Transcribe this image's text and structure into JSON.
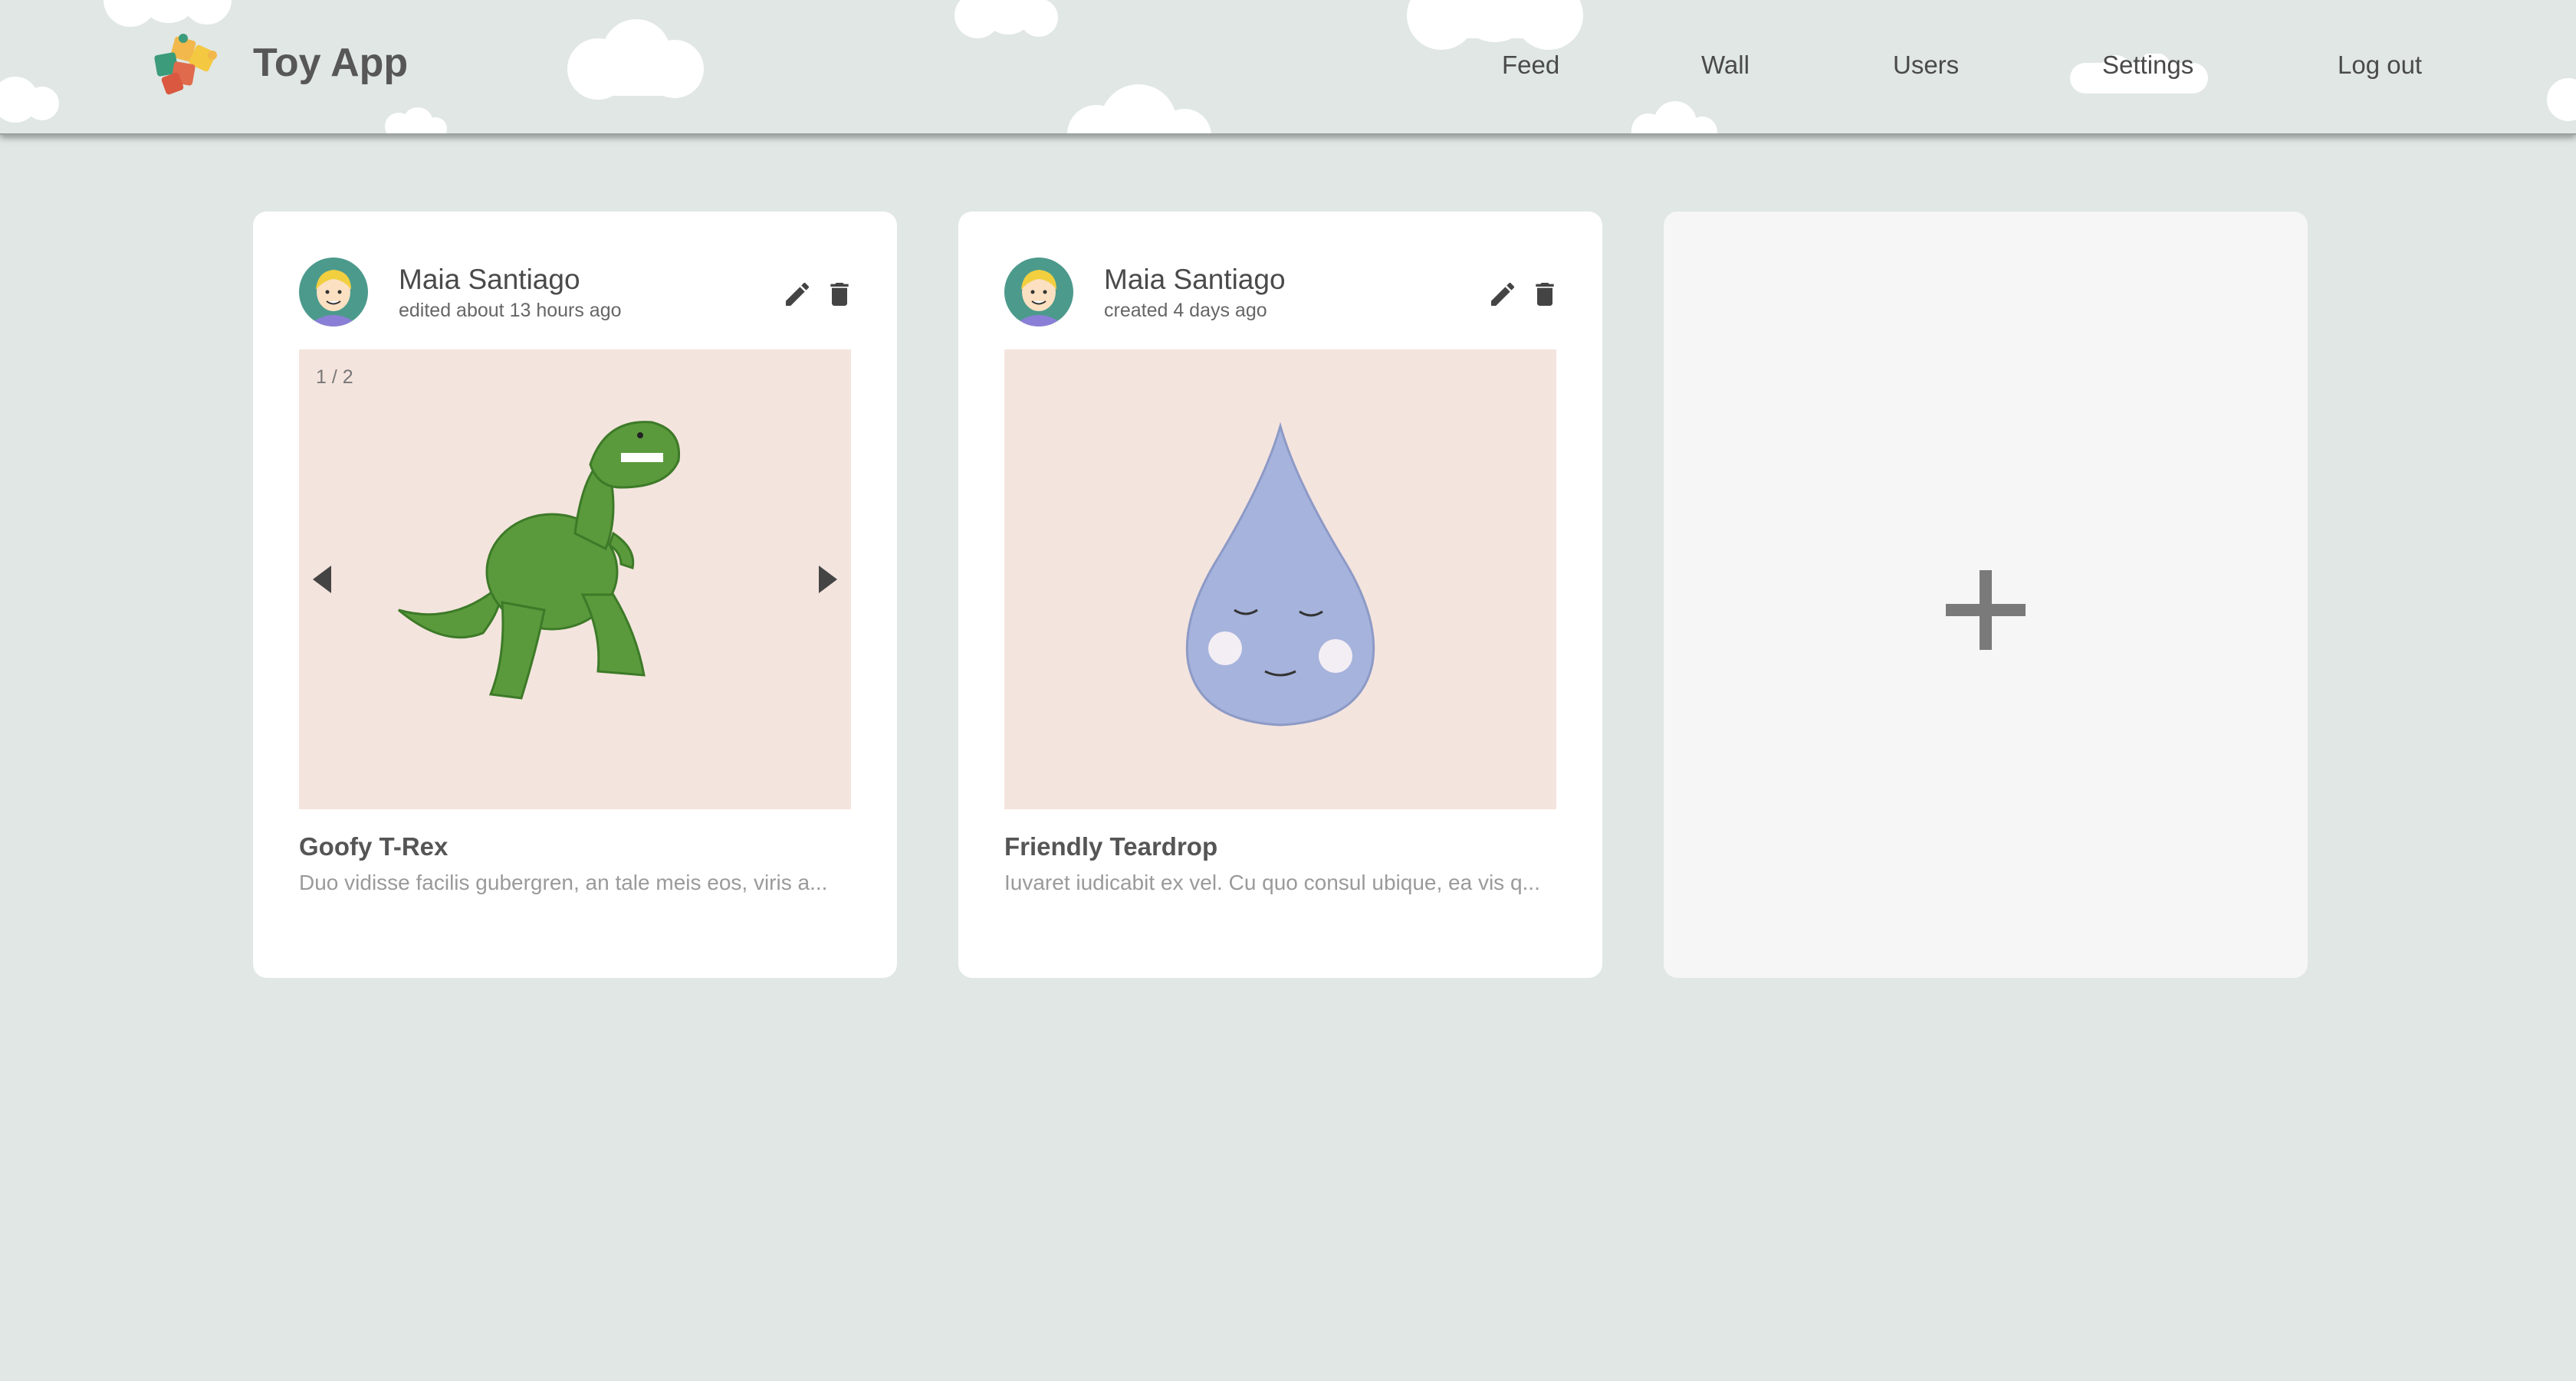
{
  "header": {
    "brand": "Toy App",
    "nav": [
      "Feed",
      "Wall",
      "Users",
      "Settings",
      "Log out"
    ]
  },
  "posts": [
    {
      "author": "Maia Santiago",
      "meta": "edited about 13 hours ago",
      "counter": "1 / 2",
      "title": "Goofy T-Rex",
      "description": "Duo vidisse facilis gubergren, an tale meis eos, viris a..."
    },
    {
      "author": "Maia Santiago",
      "meta": "created 4 days ago",
      "title": "Friendly Teardrop",
      "description": "Iuvaret iudicabit ex vel. Cu quo consul ubique, ea vis q..."
    }
  ],
  "colors": {
    "background": "#e0e7e4",
    "card": "#ffffff",
    "media": "#f4e4de",
    "add_card": "#f5f6f5"
  }
}
